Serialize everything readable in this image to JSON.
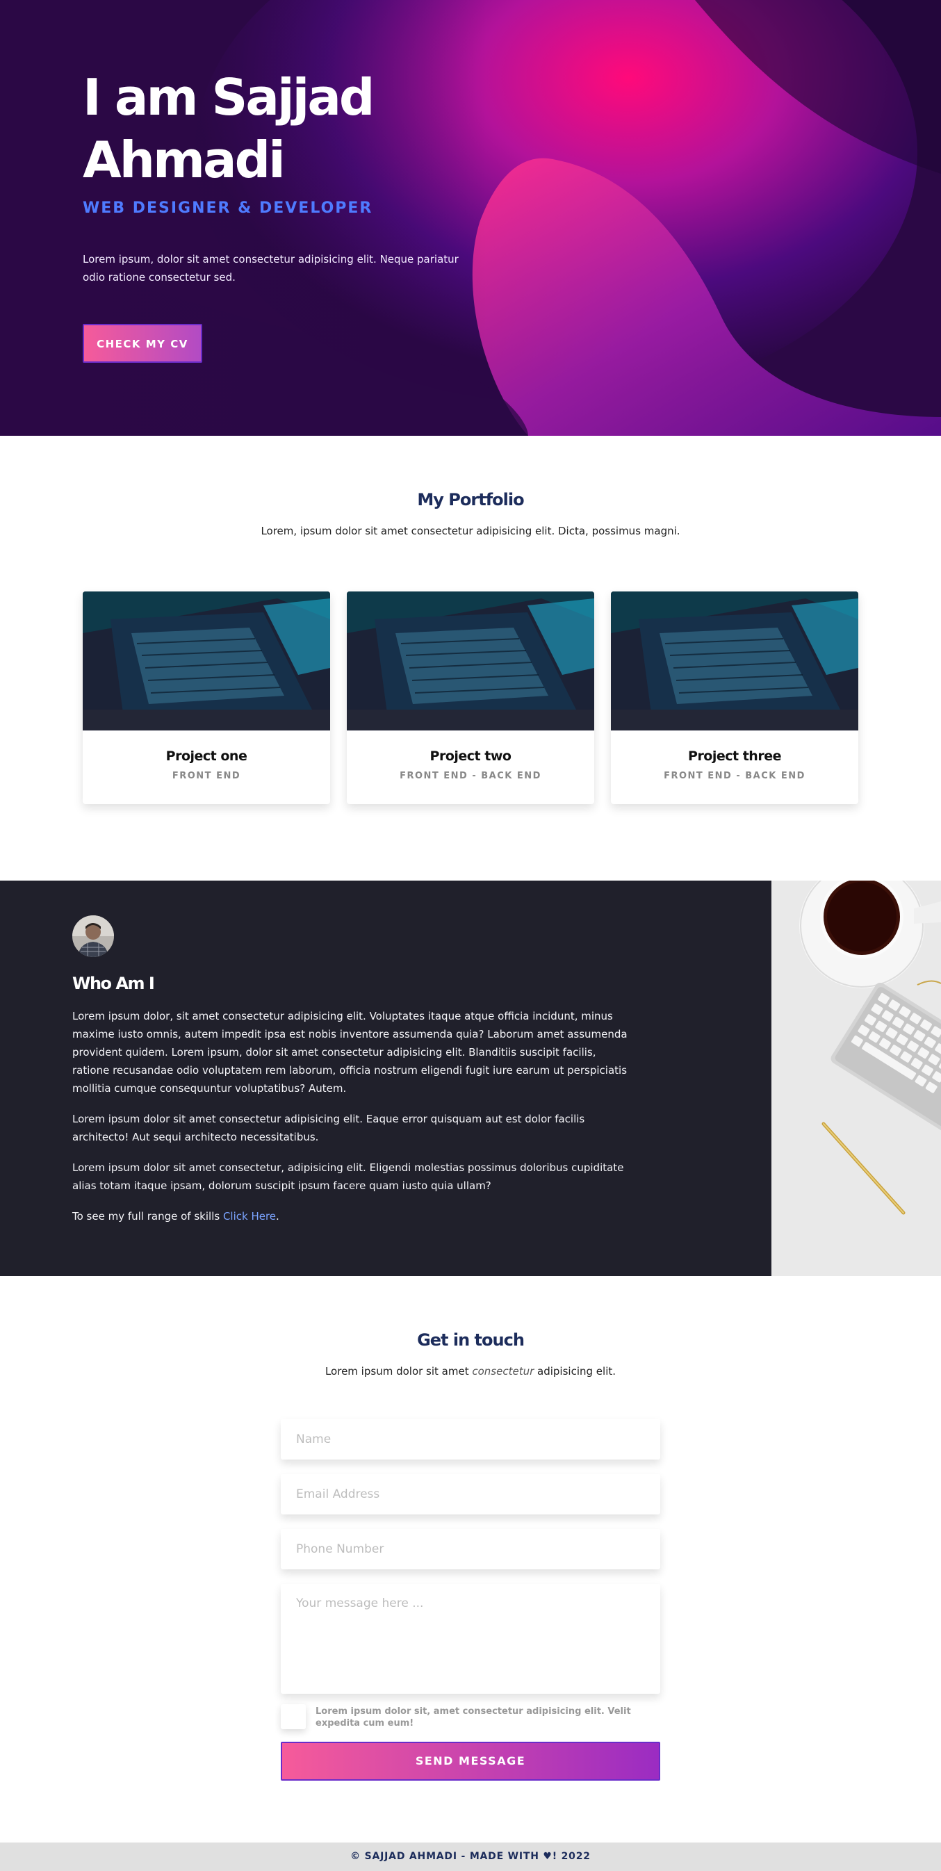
{
  "hero": {
    "title": "I am Sajjad Ahmadi",
    "role": "WEB DESIGNER & DEVELOPER",
    "intro": "Lorem ipsum, dolor sit amet consectetur adipisicing elit. Neque pariatur odio ratione consectetur sed.",
    "cta": "CHECK MY CV"
  },
  "portfolio": {
    "title": "My Portfolio",
    "subtitle": "Lorem, ipsum dolor sit amet consectetur adipisicing elit. Dicta, possimus magni.",
    "projects": [
      {
        "title": "Project one",
        "tag": "FRONT END"
      },
      {
        "title": "Project two",
        "tag": "FRONT END - BACK END"
      },
      {
        "title": "Project three",
        "tag": "FRONT END - BACK END"
      }
    ]
  },
  "about": {
    "title": "Who Am I",
    "p1": "Lorem ipsum dolor, sit amet consectetur adipisicing elit. Voluptates itaque atque officia incidunt, minus maxime iusto omnis, autem impedit ipsa est nobis inventore assumenda quia? Laborum amet assumenda provident quidem. Lorem ipsum, dolor sit amet consectetur adipisicing elit. Blanditiis suscipit facilis, ratione recusandae odio voluptatem rem laborum, officia nostrum eligendi fugit iure earum ut perspiciatis mollitia cumque consequuntur voluptatibus? Autem.",
    "p2": "Lorem ipsum dolor sit amet consectetur adipisicing elit. Eaque error quisquam aut est dolor facilis architecto! Aut sequi architecto necessitatibus.",
    "p3": "Lorem ipsum dolor sit amet consectetur, adipisicing elit. Eligendi molestias possimus doloribus cupiditate alias totam itaque ipsam, dolorum suscipit ipsum facere quam iusto quia ullam?",
    "skills_prefix": "To see my full range of skills ",
    "skills_link": "Click Here",
    "skills_suffix": "."
  },
  "contact": {
    "title": "Get in touch",
    "sub_before": "Lorem ipsum dolor sit amet ",
    "sub_em": "consectetur",
    "sub_after": " adipisicing elit.",
    "name_placeholder": "Name",
    "email_placeholder": "Email Address",
    "phone_placeholder": "Phone Number",
    "message_placeholder": "Your message here ...",
    "consent": "Lorem ipsum dolor sit, amet consectetur adipisicing elit. Velit expedita cum eum!",
    "submit": "SEND MESSAGE"
  },
  "footer": {
    "text": "© SAJJAD AHMADI - MADE WITH ♥! 2022"
  }
}
